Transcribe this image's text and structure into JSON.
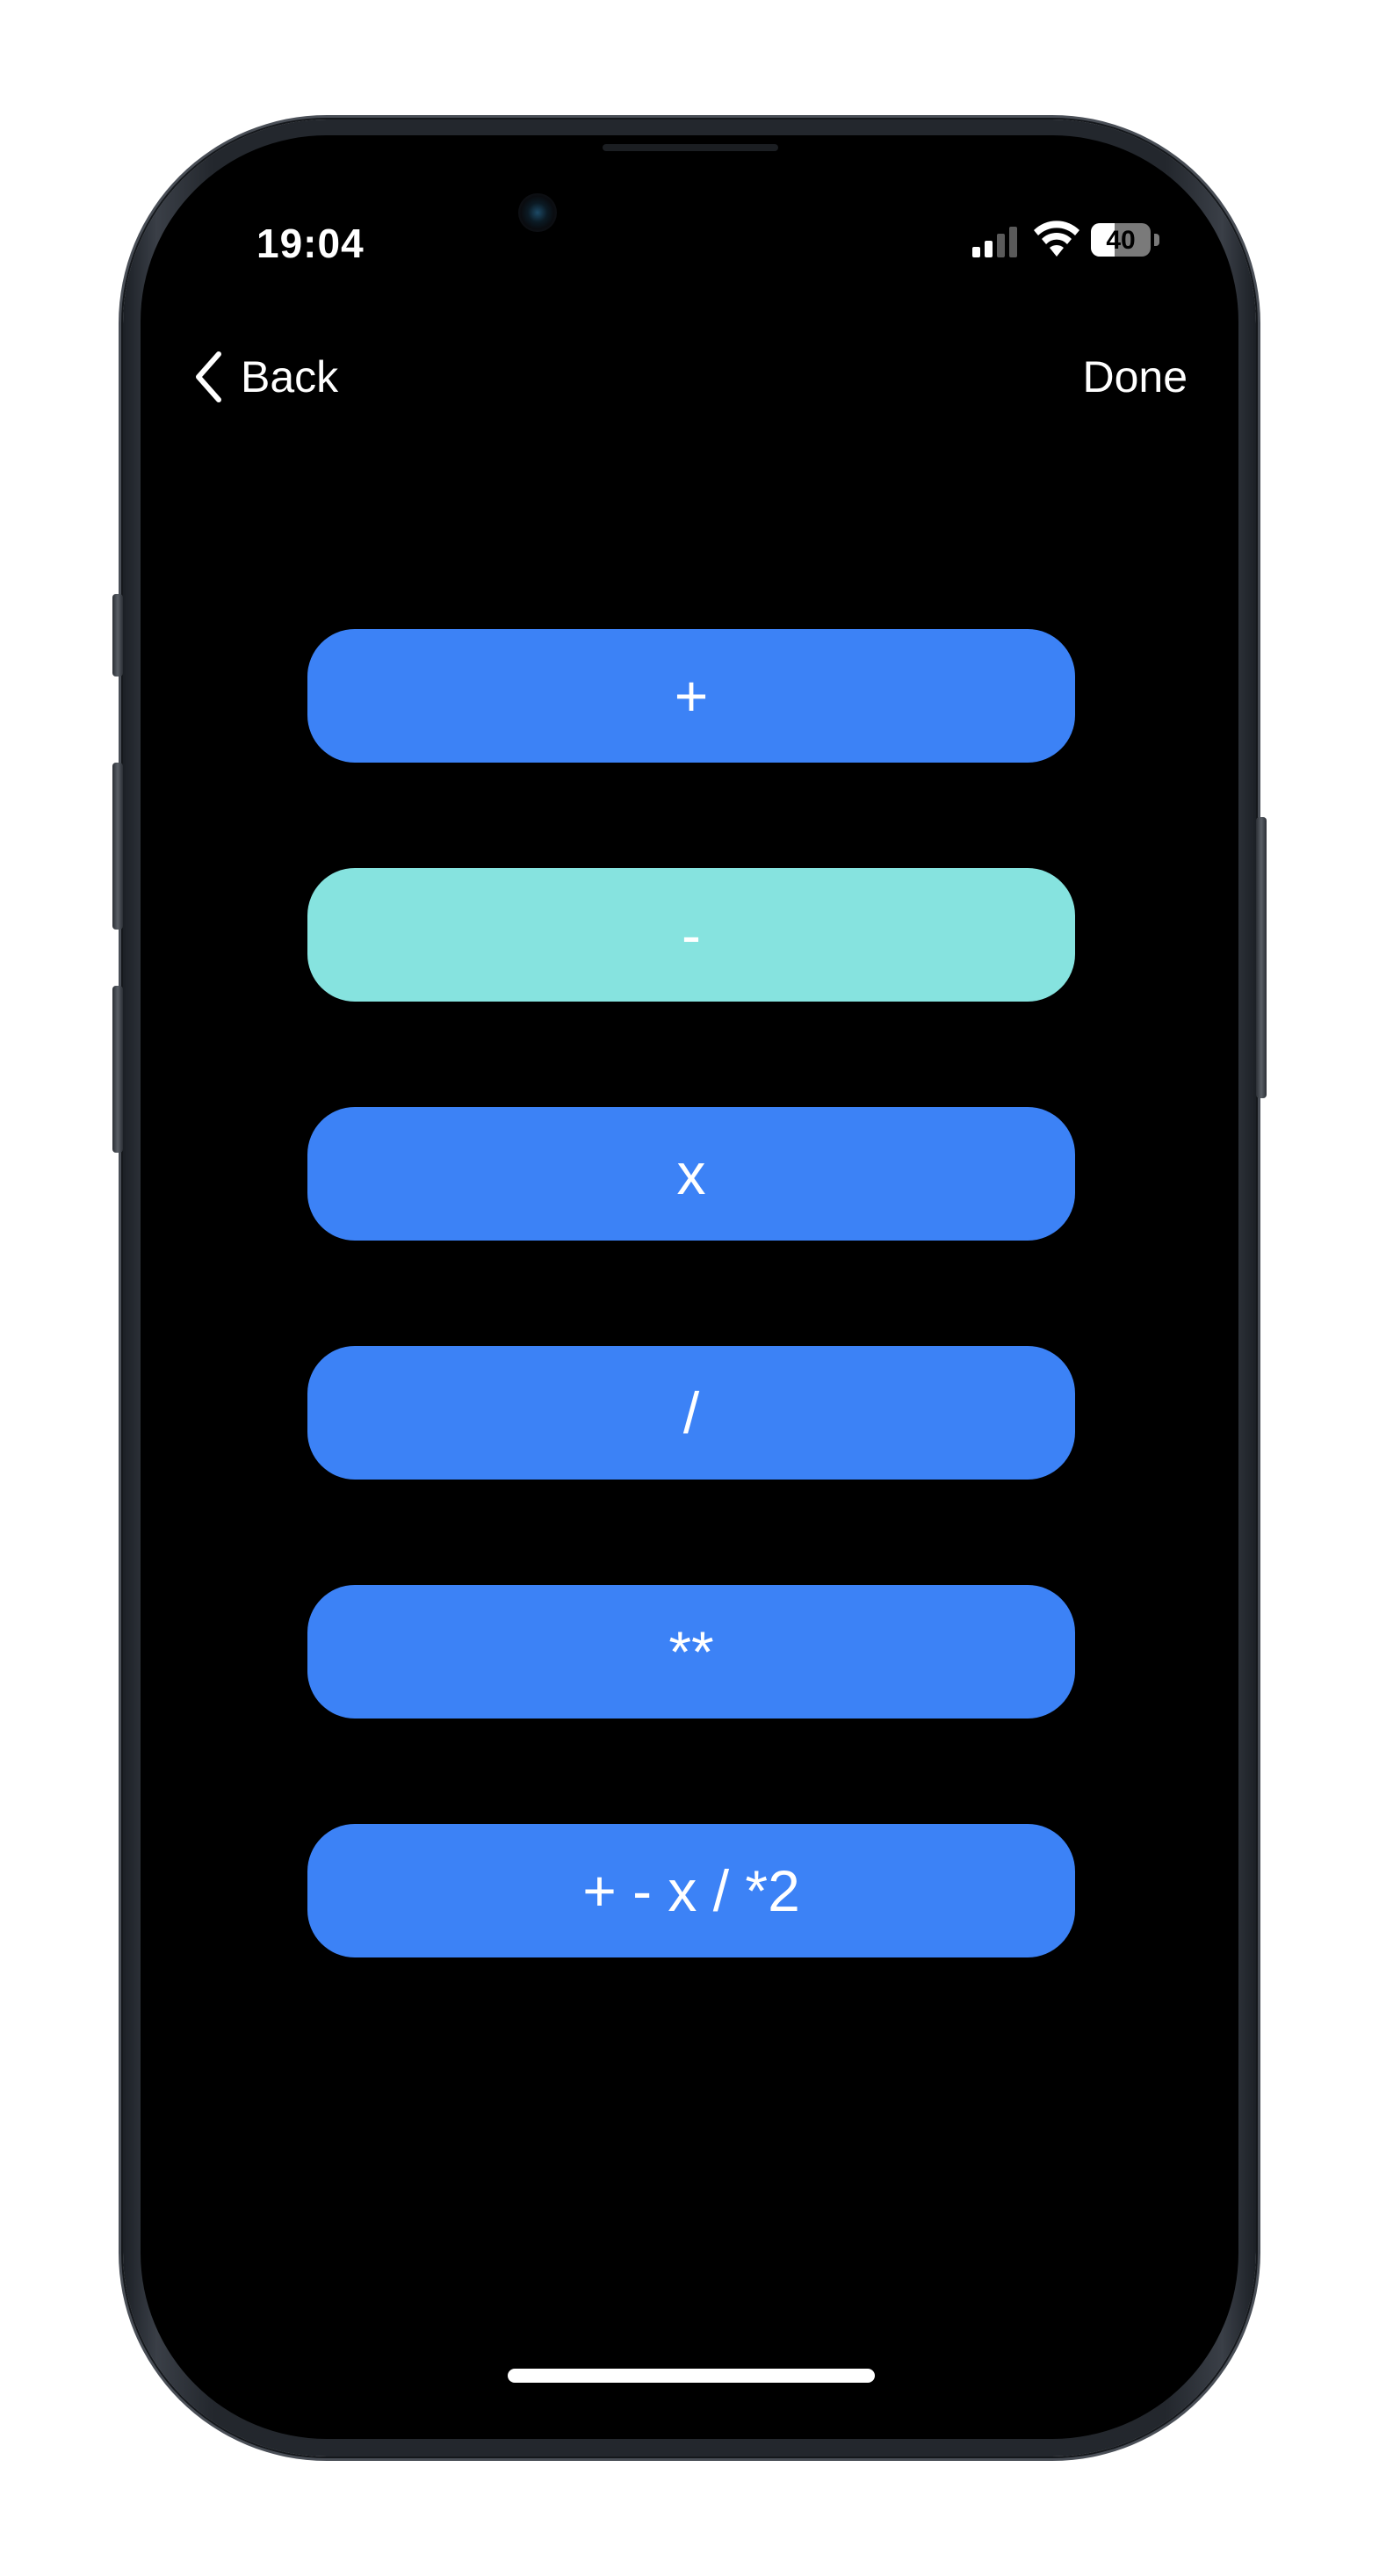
{
  "status_bar": {
    "time": "19:04",
    "signal_bars_active": 2,
    "signal_bars_total": 4,
    "wifi": "wifi-icon",
    "battery_percent": "40",
    "battery_level": 0.4
  },
  "nav": {
    "back_label": "Back",
    "done_label": "Done"
  },
  "operations": [
    {
      "label": "+",
      "selected": false
    },
    {
      "label": "-",
      "selected": true
    },
    {
      "label": "x",
      "selected": false
    },
    {
      "label": "/",
      "selected": false
    },
    {
      "label": "**",
      "selected": false
    },
    {
      "label": "+ - x / *2",
      "selected": false
    }
  ],
  "colors": {
    "button": "#3c82f6",
    "button_selected": "#86e3df",
    "background": "#000000",
    "text": "#ffffff"
  }
}
